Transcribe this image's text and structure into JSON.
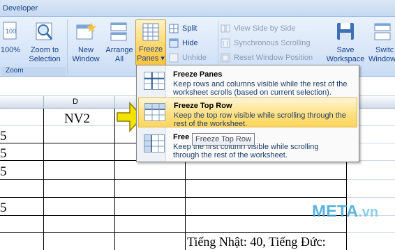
{
  "tab": {
    "label": "Developer"
  },
  "zoom_group": {
    "label": "Zoom",
    "buttons": [
      {
        "label_l1": "100%",
        "label_l2": ""
      },
      {
        "label_l1": "Zoom to",
        "label_l2": "Selection"
      }
    ]
  },
  "window_group": {
    "new_window": {
      "l1": "New",
      "l2": "Window"
    },
    "arrange_all": {
      "l1": "Arrange",
      "l2": "All"
    },
    "freeze_panes": {
      "l1": "Freeze",
      "l2": "Panes ▾"
    },
    "split": "Split",
    "hide": "Hide",
    "unhide": "Unhide",
    "view_side_by_side": "View Side by Side",
    "sync_scrolling": "Synchronous Scrolling",
    "reset_window_position": "Reset Window Position",
    "save_workspace": {
      "l1": "Save",
      "l2": "Workspace"
    },
    "switch_windows": {
      "l1": "Switc",
      "l2": "Window"
    }
  },
  "menu": {
    "items": [
      {
        "title": "Freeze Panes",
        "desc": "Keep rows and columns visible while the rest of the worksheet scrolls (based on current selection)."
      },
      {
        "title": "Freeze Top Row",
        "desc": "Keep the top row visible while scrolling through the rest of the worksheet."
      },
      {
        "title": "Freeze First Column",
        "desc": "Keep the first column visible while scrolling through the rest of the worksheet."
      }
    ],
    "item3_title_visible": "Free",
    "item3_desc_line1_visible": "Keep the first column visible while scrolling",
    "item3_desc_line2": "through the rest of the worksheet."
  },
  "tooltip": "Freeze Top Row",
  "sheet": {
    "column_header": "D",
    "cell_nv2": "NV2",
    "bottom_text": "Tiếng Nhật: 40, Tiếng Đức:",
    "left_digits": [
      "5",
      "5",
      "5",
      "5"
    ]
  },
  "watermark": {
    "main": "META",
    "suffix": ".vn"
  }
}
